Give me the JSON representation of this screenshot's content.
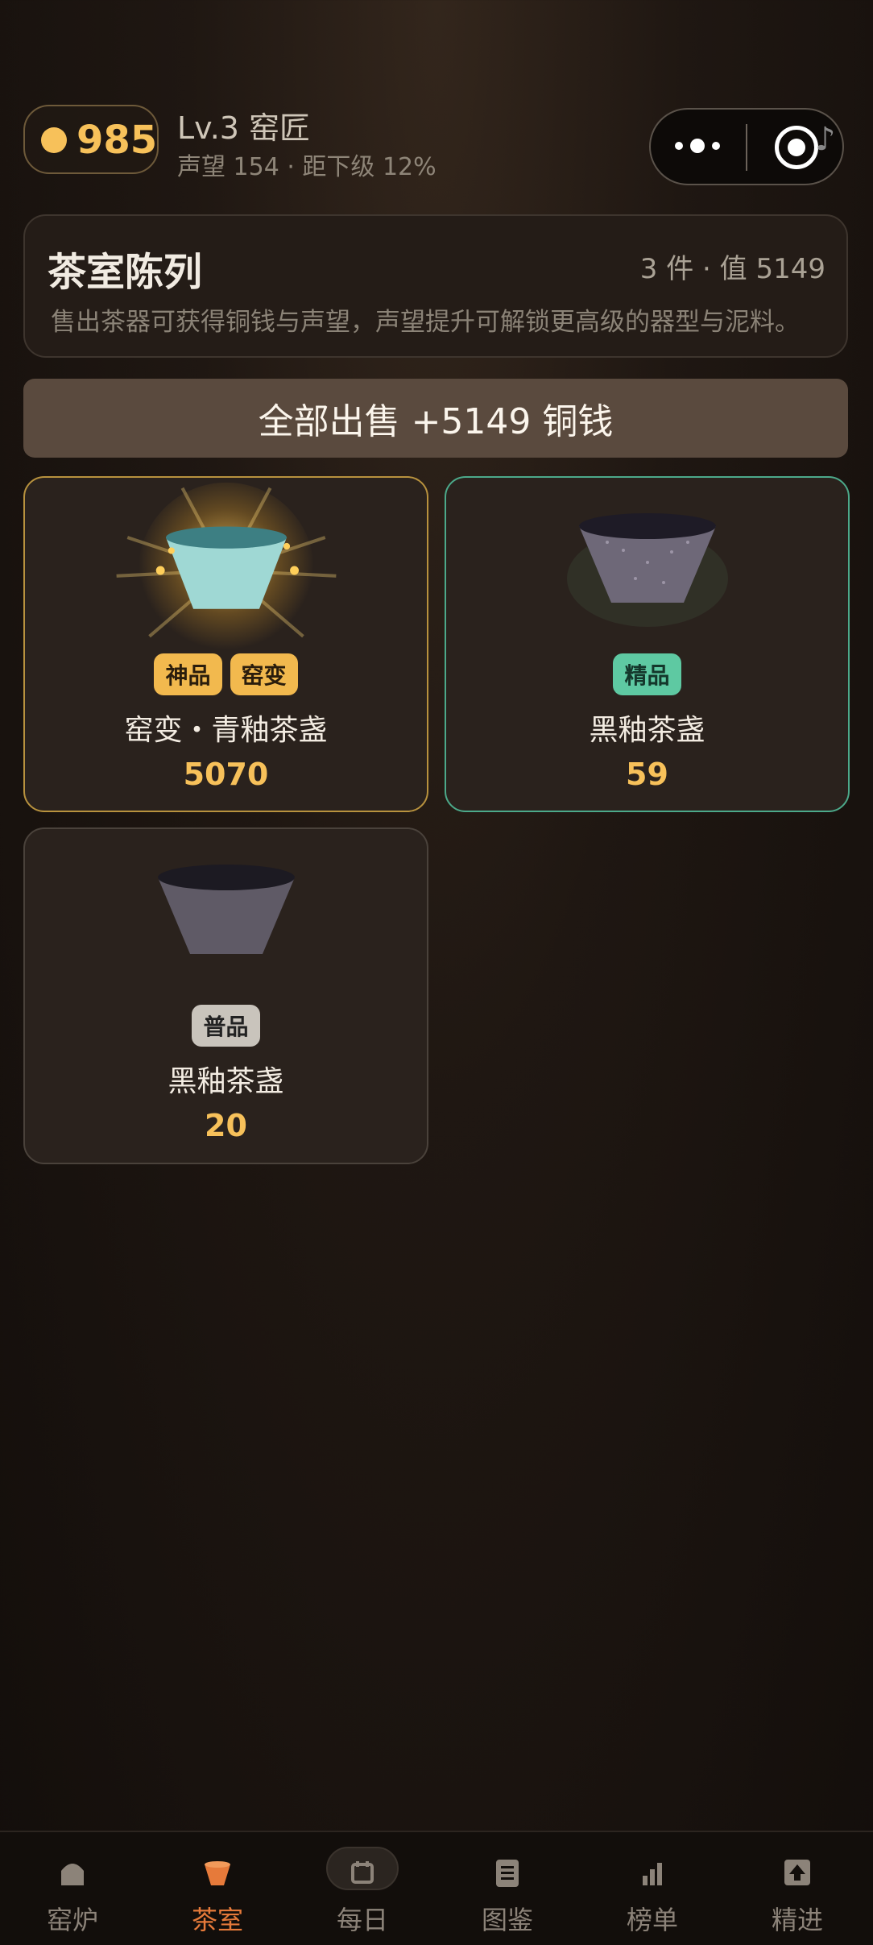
{
  "header": {
    "coins": "985",
    "level": "Lv.3 窑匠",
    "reputation": "声望 154 · 距下级 12%"
  },
  "showcase": {
    "title": "茶室陈列",
    "meta": "3 件 · 值 5149",
    "description": "售出茶器可获得铜钱与声望，声望提升可解锁更高级的器型与泥料。"
  },
  "sell_all_label": "全部出售  +5149 铜钱",
  "items": [
    {
      "badges": [
        "神品",
        "窑变"
      ],
      "name": "窑变・青釉茶盏",
      "price": "5070"
    },
    {
      "badges": [
        "精品"
      ],
      "name": "黑釉茶盏",
      "price": "59"
    },
    {
      "badges": [
        "普品"
      ],
      "name": "黑釉茶盏",
      "price": "20"
    }
  ],
  "nav": [
    {
      "label": "窑炉",
      "icon": "kiln-icon"
    },
    {
      "label": "茶室",
      "icon": "tea-cup-icon"
    },
    {
      "label": "每日",
      "icon": "calendar-icon"
    },
    {
      "label": "图鉴",
      "icon": "book-icon"
    },
    {
      "label": "榜单",
      "icon": "bar-chart-icon"
    },
    {
      "label": "精进",
      "icon": "upgrade-icon"
    }
  ],
  "colors": {
    "accent_gold": "#f7c15a",
    "accent_orange": "#e67a3a",
    "rare_green": "#5ec9a2"
  }
}
